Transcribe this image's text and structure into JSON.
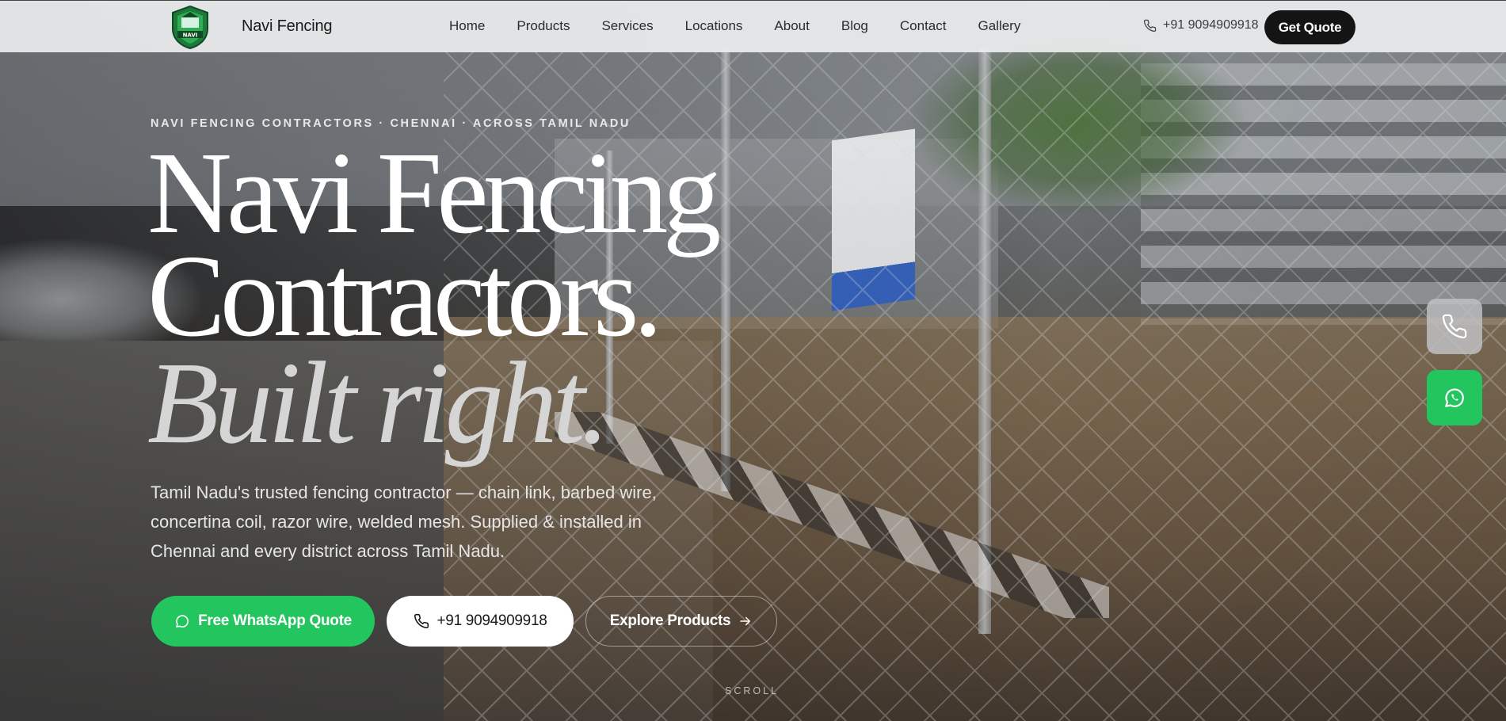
{
  "nav": {
    "brand": "Navi Fencing",
    "logo_text": "NAVI",
    "items": [
      {
        "label": "Home"
      },
      {
        "label": "Products"
      },
      {
        "label": "Services"
      },
      {
        "label": "Locations"
      },
      {
        "label": "About"
      },
      {
        "label": "Blog"
      },
      {
        "label": "Contact"
      },
      {
        "label": "Gallery"
      }
    ],
    "phone": "+91 9094909918",
    "cta": "Get Quote"
  },
  "hero": {
    "eyebrow": "NAVI FENCING CONTRACTORS · CHENNAI · ACROSS TAMIL NADU",
    "headline_line1": "Navi Fencing",
    "headline_line2": "Contractors.",
    "headline_line3": "Built right.",
    "lead": "Tamil Nadu's trusted fencing contractor — chain link, barbed wire, concertina coil, razor wire, welded mesh. Supplied & installed in Chennai and every district across Tamil Nadu.",
    "buttons": {
      "whatsapp": "Free WhatsApp Quote",
      "phone": "+91 9094909918",
      "explore": "Explore Products"
    },
    "scroll_label": "SCROLL"
  },
  "colors": {
    "whatsapp_green": "#22c55e",
    "cta_dark": "#141414",
    "nav_bg": "#ecedee"
  },
  "icons": {
    "phone": "phone-icon",
    "whatsapp": "whatsapp-icon",
    "arrow": "arrow-right-icon"
  }
}
